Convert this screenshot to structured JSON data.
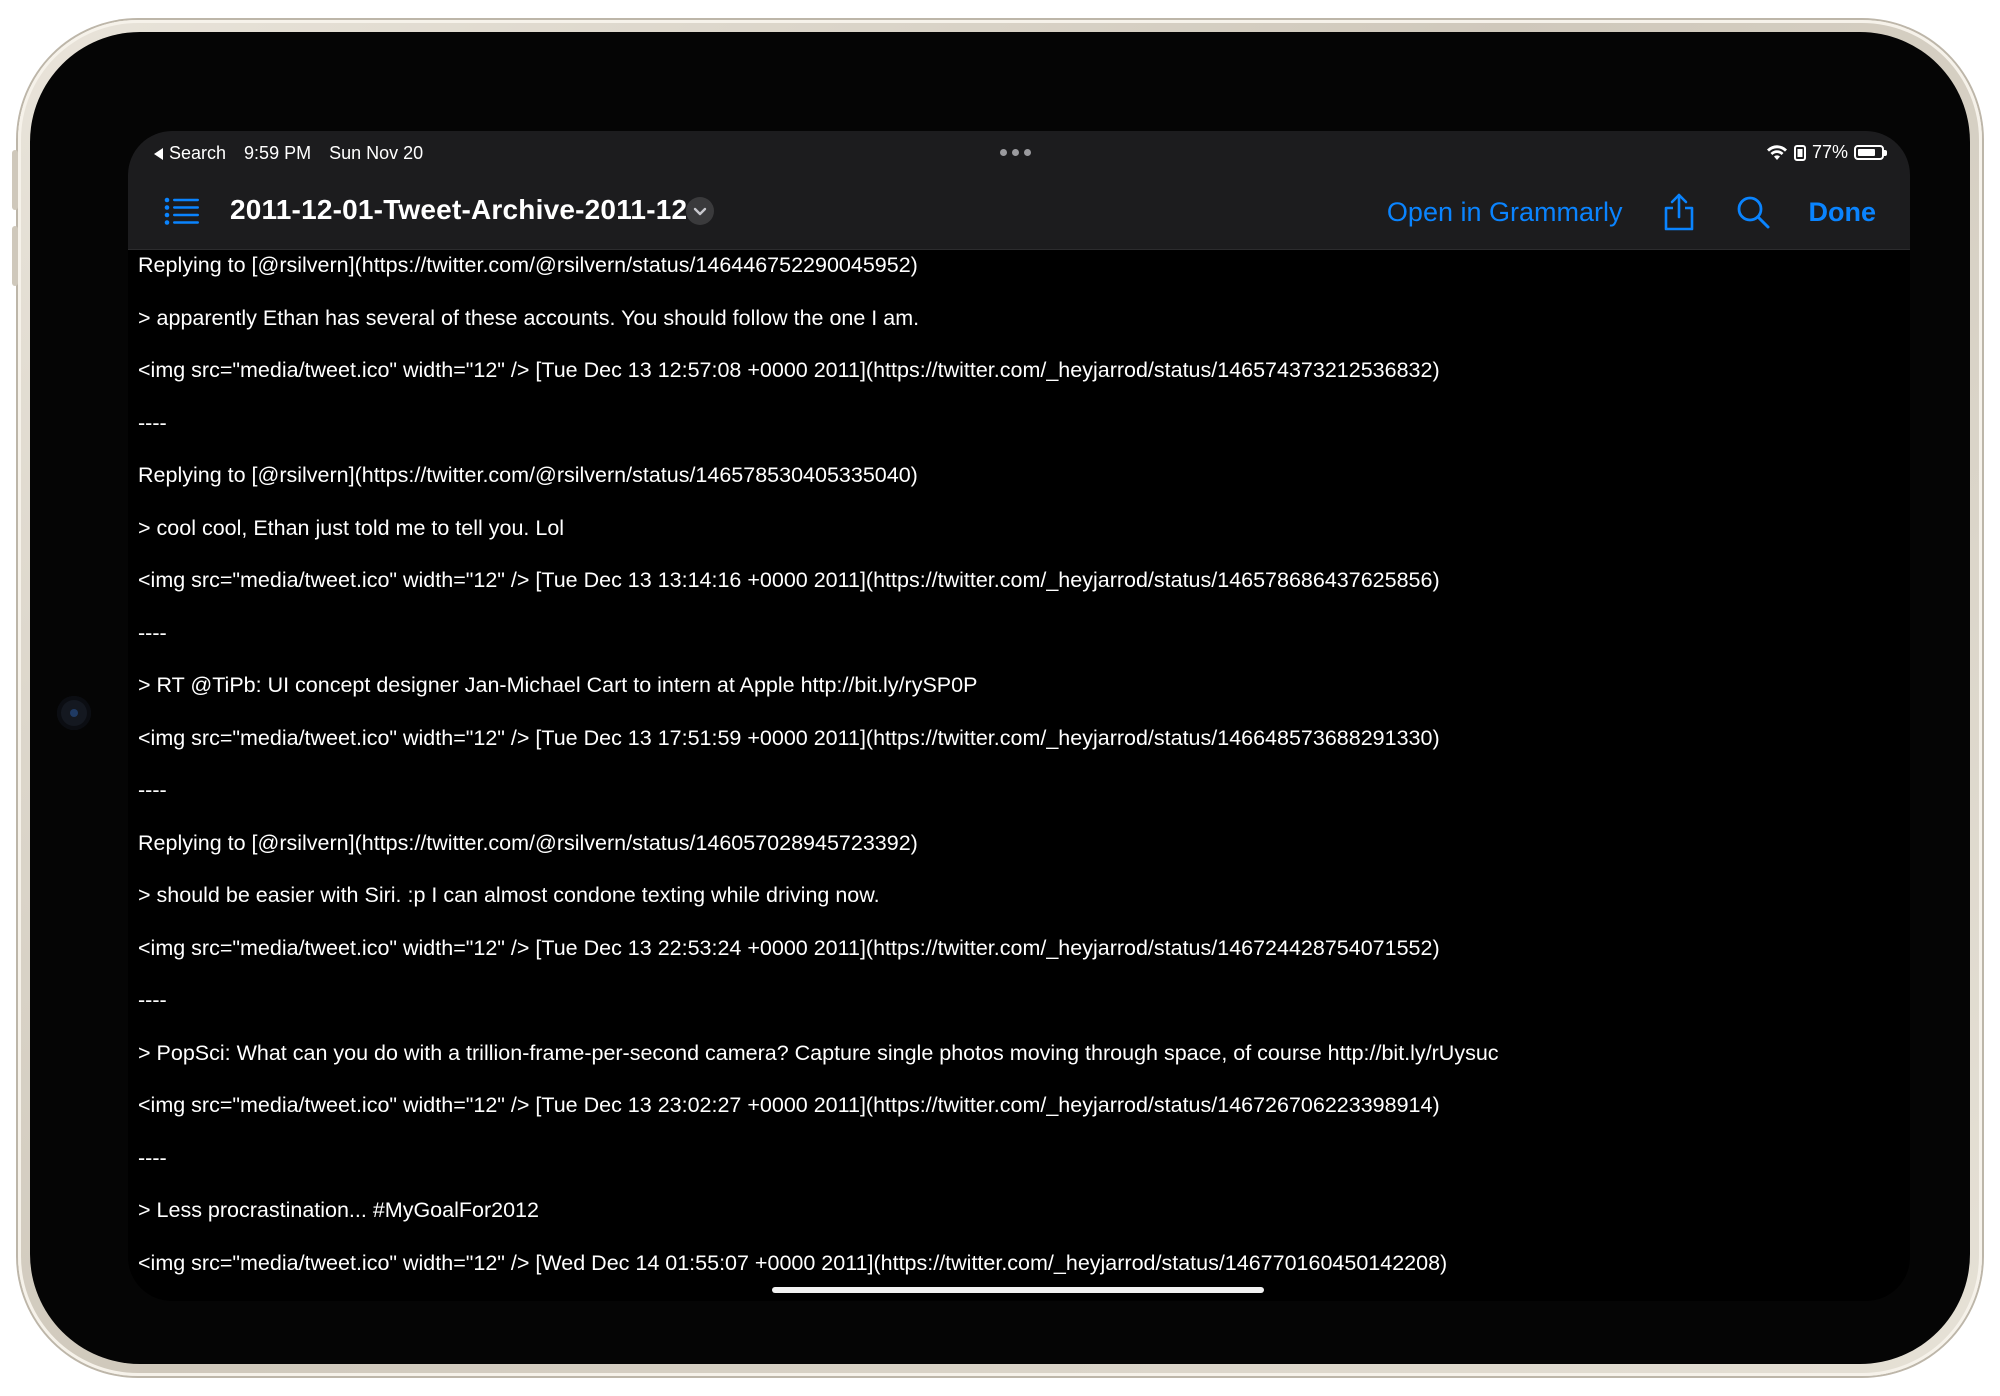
{
  "status_bar": {
    "back_label": "Search",
    "time": "9:59 PM",
    "date": "Sun Nov 20",
    "battery_percent": "77%",
    "battery_level": 0.77
  },
  "nav_bar": {
    "document_title": "2011-12-01-Tweet-Archive-2011-12",
    "open_in_label": "Open in Grammarly",
    "done_label": "Done",
    "icons": [
      "list-icon",
      "chevron-down-icon",
      "share-icon",
      "search-icon"
    ]
  },
  "content": {
    "lines": [
      "Replying to [@rsilvern](https://twitter.com/@rsilvern/status/146446752290045952)",
      "> apparently Ethan has several of these accounts. You should follow the one I am.",
      "<img src=\"media/tweet.ico\" width=\"12\" /> [Tue Dec 13 12:57:08 +0000 2011](https://twitter.com/_heyjarrod/status/146574373212536832)",
      "----",
      "Replying to [@rsilvern](https://twitter.com/@rsilvern/status/146578530405335040)",
      "> cool cool, Ethan just told me to tell you. Lol",
      "<img src=\"media/tweet.ico\" width=\"12\" /> [Tue Dec 13 13:14:16 +0000 2011](https://twitter.com/_heyjarrod/status/146578686437625856)",
      "----",
      "> RT @TiPb: UI concept designer Jan-Michael Cart to intern at Apple http://bit.ly/rySP0P",
      "<img src=\"media/tweet.ico\" width=\"12\" /> [Tue Dec 13 17:51:59 +0000 2011](https://twitter.com/_heyjarrod/status/146648573688291330)",
      "----",
      "Replying to [@rsilvern](https://twitter.com/@rsilvern/status/146057028945723392)",
      "> should be easier with Siri. :p I can almost condone texting while driving now.",
      "<img src=\"media/tweet.ico\" width=\"12\" /> [Tue Dec 13 22:53:24 +0000 2011](https://twitter.com/_heyjarrod/status/146724428754071552)",
      "----",
      "> PopSci: What can you do with a trillion-frame-per-second camera? Capture single photos moving through space, of course http://bit.ly/rUysuc",
      "<img src=\"media/tweet.ico\" width=\"12\" /> [Tue Dec 13 23:02:27 +0000 2011](https://twitter.com/_heyjarrod/status/146726706223398914)",
      "----",
      "> Less procrastination... #MyGoalFor2012",
      "<img src=\"media/tweet.ico\" width=\"12\" /> [Wed Dec 14 01:55:07 +0000 2011](https://twitter.com/_heyjarrod/status/146770160450142208)"
    ]
  },
  "colors": {
    "accent": "#0a84ff",
    "background": "#000000",
    "bar_background": "#1c1c1e",
    "text": "#ffffff"
  }
}
